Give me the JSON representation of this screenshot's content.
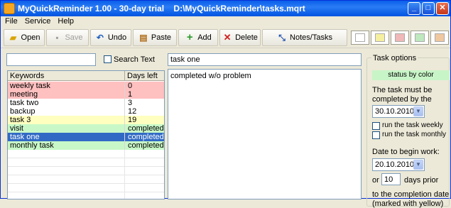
{
  "window": {
    "title": "MyQuickReminder 1.00 - 30-day trial    D:\\MyQuickReminder\\tasks.mqrt",
    "minimize": "_",
    "maximize": "□",
    "close": "✕"
  },
  "menu": [
    "File",
    "Service",
    "Help"
  ],
  "toolbar": {
    "open": "Open",
    "save": "Save",
    "undo": "Undo",
    "paste": "Paste",
    "add": "Add",
    "delete": "Delete",
    "notes": "Notes/Tasks",
    "swatch_colors": [
      "#ffffff",
      "#f5f0a0",
      "#f0b8b8",
      "#bfe8bf",
      "#f0c8a0"
    ]
  },
  "search": {
    "value": "",
    "label": "Search Text"
  },
  "task_title": "task one",
  "grid": {
    "col1": "Keywords",
    "col2": "Days left",
    "rows": [
      {
        "keyword": "weekly task",
        "days": "0",
        "color": "#ffc0c0",
        "selected": false
      },
      {
        "keyword": "meeting",
        "days": "1",
        "color": "#ffc0c0",
        "selected": false
      },
      {
        "keyword": "task two",
        "days": "3",
        "color": "#ffffff",
        "selected": false
      },
      {
        "keyword": "backup",
        "days": "12",
        "color": "#ffffff",
        "selected": false
      },
      {
        "keyword": "task 3",
        "days": "19",
        "color": "#ffffc0",
        "selected": false
      },
      {
        "keyword": "visit",
        "days": "completed",
        "color": "#c8f8c8",
        "selected": false
      },
      {
        "keyword": "task one",
        "days": "completed",
        "color": "#316ac5",
        "selected": true
      },
      {
        "keyword": "monthly task",
        "days": "completed",
        "color": "#c8f8c8",
        "selected": false
      }
    ]
  },
  "memo": "completed w/o problem",
  "options": {
    "title": "Task options",
    "status": "status by color",
    "must_be_completed": "The task must be completed by the date:",
    "due_date": "30.10.2010",
    "weekly": "run the task weekly",
    "monthly": "run the task monthly",
    "begin_label": "Date to begin work:",
    "begin_date": "20.10.2010",
    "or": "or",
    "days_value": "10",
    "days_prior": "days prior",
    "to_completion": "to the completion date",
    "marked": "(marked with yellow)"
  }
}
